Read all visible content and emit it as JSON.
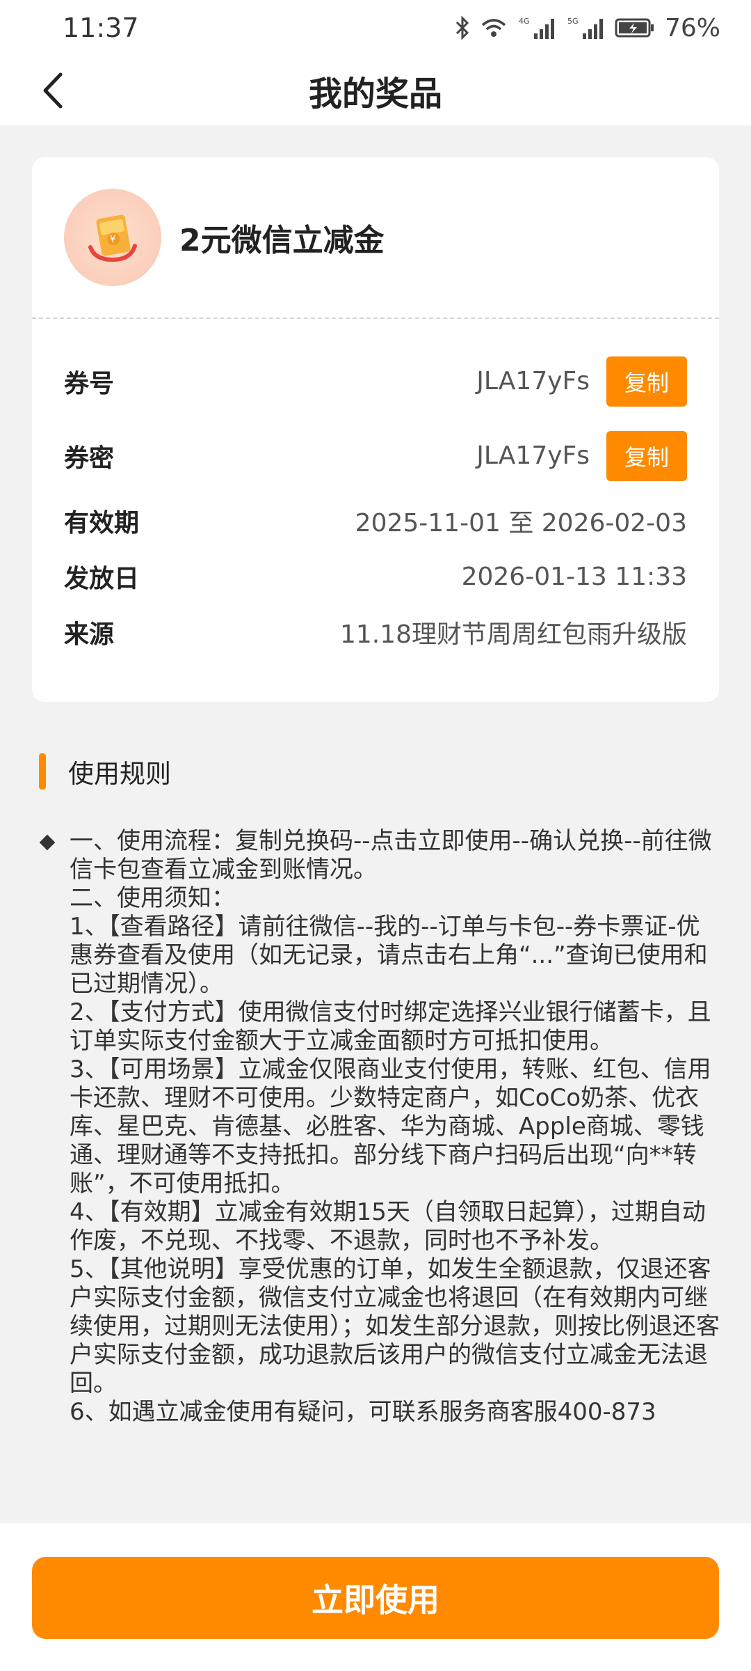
{
  "status_bar": {
    "time": "11:37",
    "network_4g": "4G",
    "network_5g": "5G",
    "battery": "76%"
  },
  "nav": {
    "title": "我的奖品"
  },
  "prize": {
    "name": "2元微信立减金",
    "icon": "red-envelope-coupon-icon"
  },
  "info": {
    "coupon_no_label": "券号",
    "coupon_no_value": "JLA17yFs",
    "coupon_pwd_label": "券密",
    "coupon_pwd_value": "JLA17yFs",
    "copy_label": "复制",
    "validity_label": "有效期",
    "validity_value": "2025-11-01 至 2026-02-03",
    "issue_label": "发放日",
    "issue_value": "2026-01-13 11:33",
    "source_label": "来源",
    "source_value": "11.18理财节周周红包雨升级版"
  },
  "rules": {
    "title": "使用规则",
    "lines": [
      "一、使用流程：复制兑换码--点击立即使用--确认兑换--前往微信卡包查看立减金到账情况。",
      "二、使用须知：",
      "1、【查看路径】请前往微信--我的--订单与卡包--券卡票证-优惠券查看及使用（如无记录，请点击右上角“...”查询已使用和已过期情况）。",
      "2、【支付方式】使用微信支付时绑定选择兴业银行储蓄卡，且订单实际支付金额大于立减金面额时方可抵扣使用。",
      "3、【可用场景】立减金仅限商业支付使用，转账、红包、信用卡还款、理财不可使用。少数特定商户，如CoCo奶茶、优衣库、星巴克、肯德基、必胜客、华为商城、Apple商城、零钱通、理财通等不支持抵扣。部分线下商户扫码后出现“向**转账”，不可使用抵扣。",
      "4、【有效期】立减金有效期15天（自领取日起算），过期自动作废，不兑现、不找零、不退款，同时也不予补发。",
      "5、【其他说明】享受优惠的订单，如发生全额退款，仅退还客户实际支付金额，微信支付立减金也将退回（在有效期内可继续使用，过期则无法使用）；如发生部分退款，则按比例退还客户实际支付金额，成功退款后该用户的微信支付立减金无法退回。",
      "6、如遇立减金使用有疑问，可联系服务商客服400-873"
    ]
  },
  "bottom": {
    "use_now_label": "立即使用"
  }
}
